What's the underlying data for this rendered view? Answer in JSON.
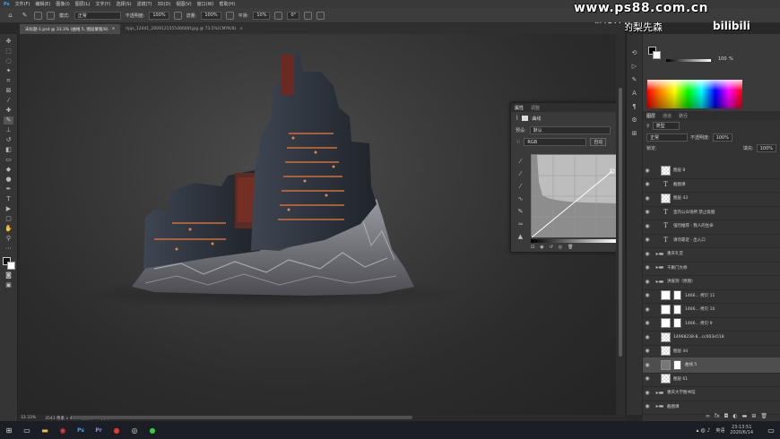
{
  "menu": [
    "文件(F)",
    "编辑(E)",
    "图像(I)",
    "图层(L)",
    "文字(Y)",
    "选择(S)",
    "滤镜(T)",
    "3D(D)",
    "视图(V)",
    "窗口(W)",
    "帮助(H)"
  ],
  "options": {
    "mode_label": "模式:",
    "mode_value": "正常",
    "opacity_label": "不透明度:",
    "opacity_value": "100%",
    "flow_label": "流量:",
    "flow_value": "100%",
    "smooth_label": "平滑:",
    "smooth_value": "10%",
    "angle_value": "0°"
  },
  "tabs": [
    {
      "label": "未标题-1.psd @ 33.3% (曲线 5, 图层蒙版/8)",
      "active": true
    },
    {
      "label": "hjqs_12441_200912155546600f.jpg @ 73.5%(CMYK/8)",
      "active": false
    }
  ],
  "status": {
    "zoom": "33.33%",
    "doc": "3543 像素 x 4961 像素 (300 ppi)"
  },
  "watermark": {
    "url": "www.ps88.com.cn",
    "tagline": "做设计的梨先森",
    "brand": "bilibili"
  },
  "color_panel": {
    "value": "100",
    "unit": "%"
  },
  "properties": {
    "tabs": [
      "属性",
      "调整"
    ],
    "title": "曲线",
    "preset_label": "预设:",
    "preset_value": "默认",
    "channel_value": "RGB",
    "auto_label": "自动"
  },
  "layers": {
    "tabs": [
      "图层",
      "通道",
      "路径"
    ],
    "filter_value": "类型",
    "blend_value": "正常",
    "opacity_label": "不透明度:",
    "opacity_value": "100%",
    "lock_label": "锁定:",
    "fill_label": "填充:",
    "fill_value": "100%",
    "rows": [
      {
        "type": "image",
        "label": "图层 8"
      },
      {
        "type": "text",
        "label": "截图课"
      },
      {
        "type": "image",
        "label": "图层 43"
      },
      {
        "type": "text",
        "label": "室内公众场所 禁止吸烟"
      },
      {
        "type": "text",
        "label": "强烈推荐 · 我人的生命"
      },
      {
        "type": "text",
        "label": "请勿靠近 · 出入口"
      },
      {
        "type": "folder",
        "label": "重庆礼堂"
      },
      {
        "type": "folder",
        "label": "千厮门大桥"
      },
      {
        "type": "folder",
        "label": "洪崖洞（原图）"
      },
      {
        "type": "masked",
        "label": "1466... 拷贝 11"
      },
      {
        "type": "masked",
        "label": "1466... 拷贝 10"
      },
      {
        "type": "masked",
        "label": "1466... 拷贝 9"
      },
      {
        "type": "image",
        "label": "14968238-8...cc003e518"
      },
      {
        "type": "image",
        "label": "图层 44"
      },
      {
        "type": "adjust",
        "label": "曲线 5"
      },
      {
        "type": "image",
        "label": "图层 61"
      },
      {
        "type": "folder",
        "label": "重庆大学图书馆"
      },
      {
        "type": "folder",
        "label": "截图课"
      }
    ]
  },
  "taskbar": {
    "time": "23:13:51",
    "date": "2020/6/14",
    "ime": "英语"
  }
}
